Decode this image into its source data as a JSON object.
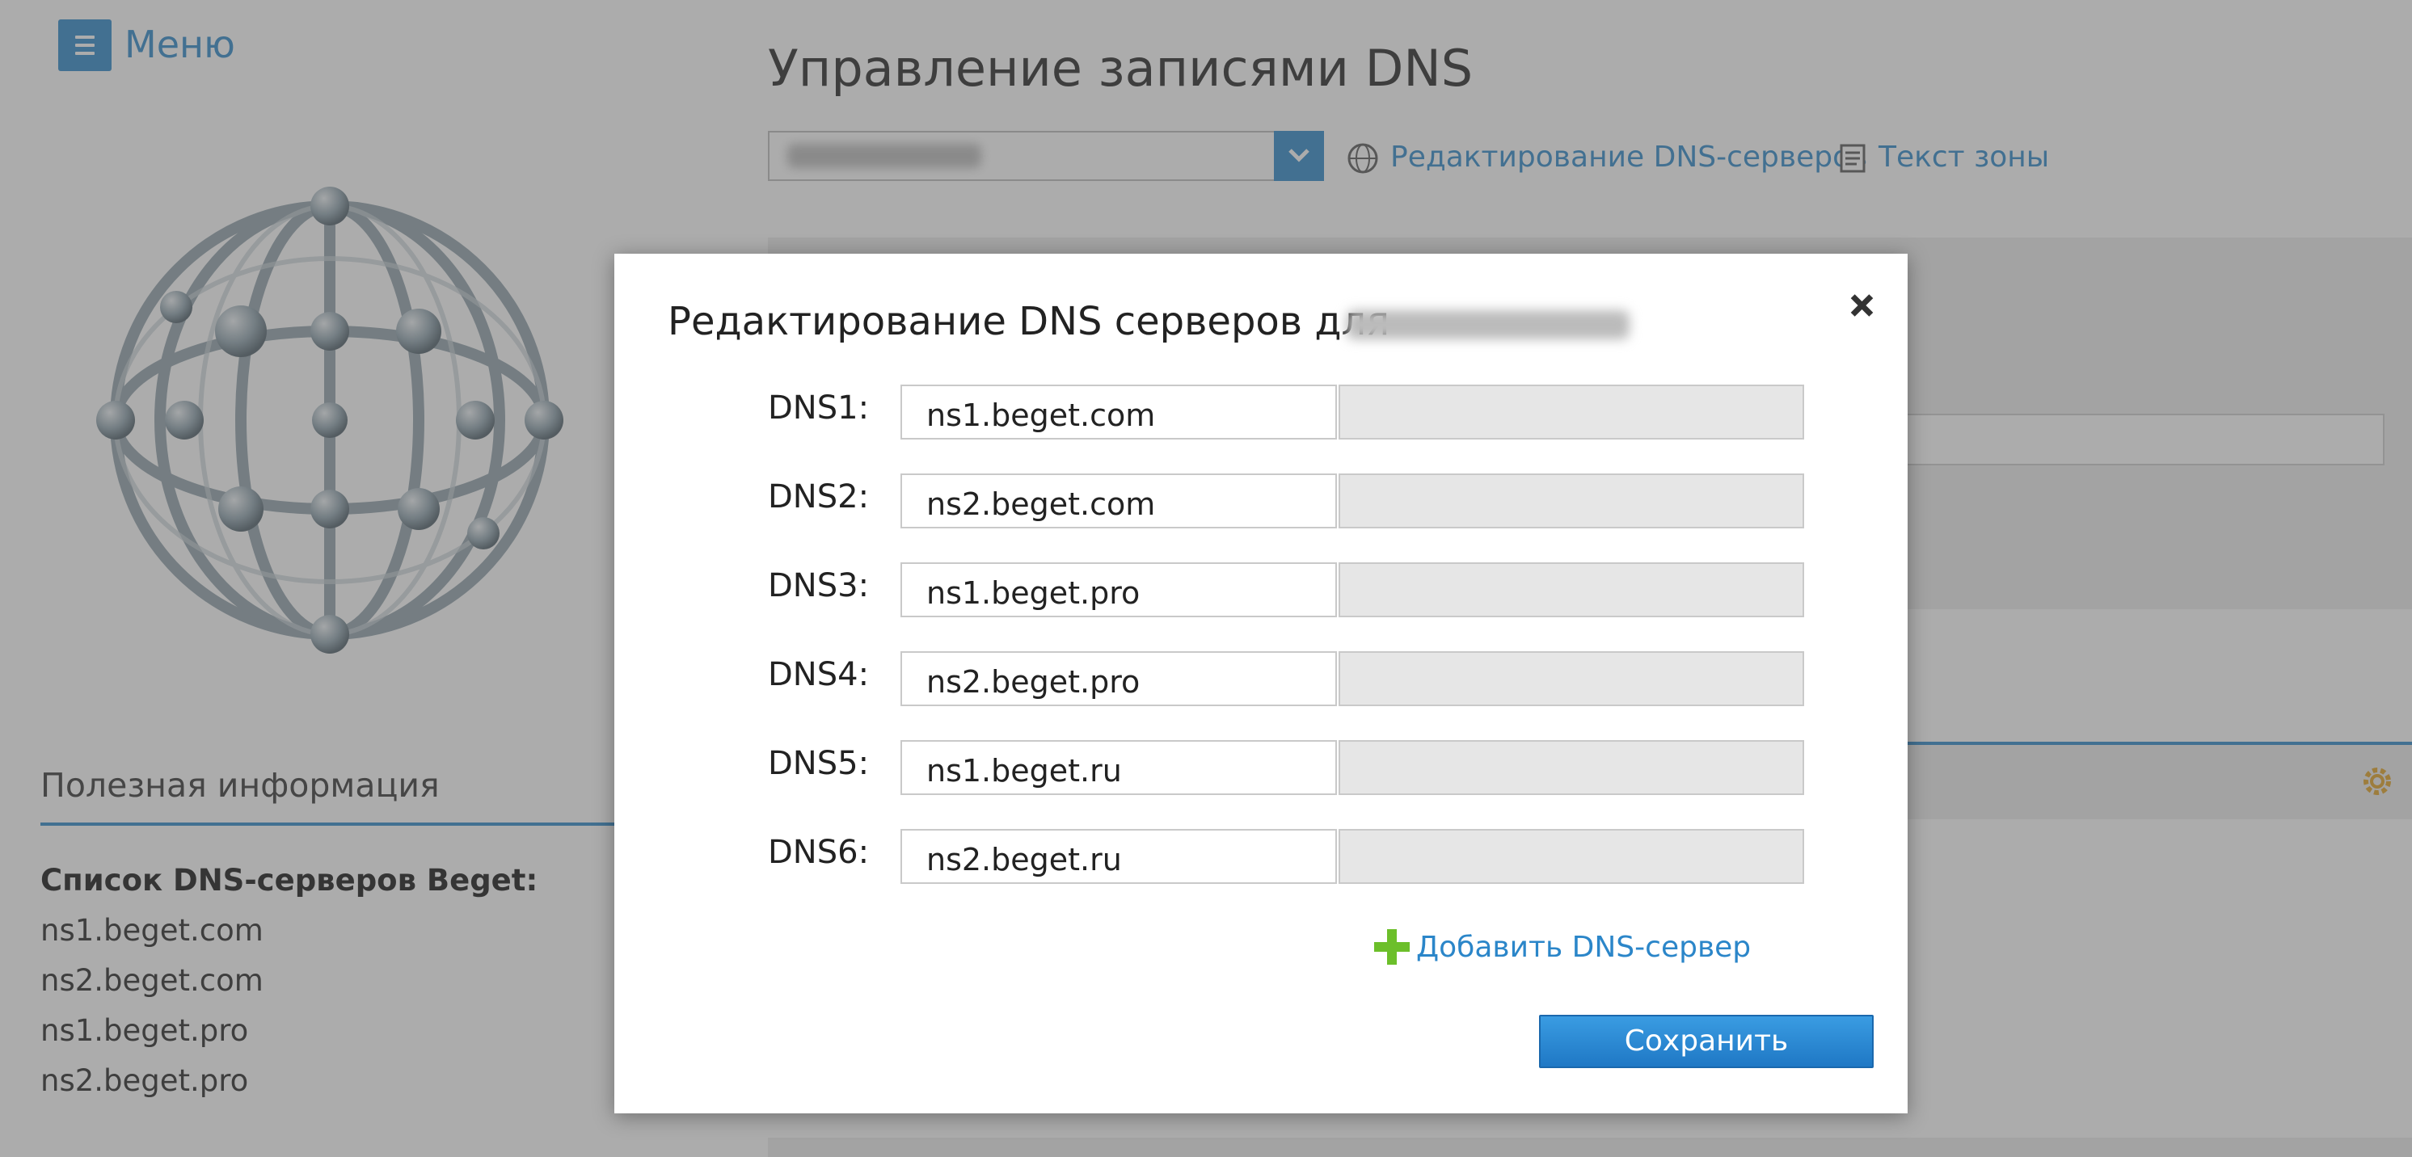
{
  "sidebar": {
    "menu_label": "Меню",
    "useful_info_title": "Полезная информация",
    "dns_list_title": "Список DNS-серверов Beget:",
    "dns_list": [
      "ns1.beget.com",
      "ns2.beget.com",
      "ns1.beget.pro",
      "ns2.beget.pro"
    ]
  },
  "main": {
    "title": "Управление записями DNS",
    "domain_select_value": "",
    "edit_dns_link": "Редактирование DNS-серверов",
    "zone_text_link": "Текст зоны"
  },
  "modal": {
    "title": "Редактирование DNS серверов для",
    "rows": [
      {
        "label": "DNS1:",
        "value": "ns1.beget.com",
        "ip": ""
      },
      {
        "label": "DNS2:",
        "value": "ns2.beget.com",
        "ip": ""
      },
      {
        "label": "DNS3:",
        "value": "ns1.beget.pro",
        "ip": ""
      },
      {
        "label": "DNS4:",
        "value": "ns2.beget.pro",
        "ip": ""
      },
      {
        "label": "DNS5:",
        "value": "ns1.beget.ru",
        "ip": ""
      },
      {
        "label": "DNS6:",
        "value": "ns2.beget.ru",
        "ip": ""
      }
    ],
    "add_server_label": "Добавить DNS-сервер",
    "save_label": "Сохранить"
  },
  "colors": {
    "accent": "#2b86c9",
    "add_icon": "#6cbf2a",
    "overlay": "rgba(90,90,90,0.5)"
  },
  "icons": [
    "menu-icon",
    "globe-illustration",
    "chevron-down-icon",
    "www-icon",
    "document-icon",
    "gear-icon",
    "close-icon",
    "plus-icon"
  ]
}
